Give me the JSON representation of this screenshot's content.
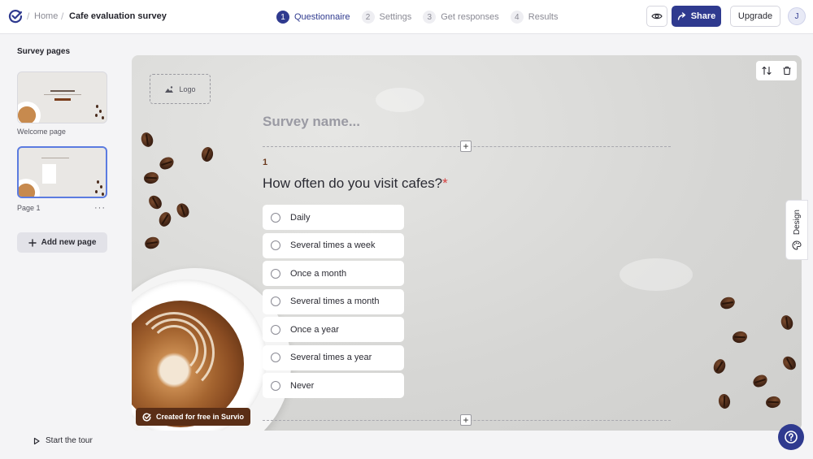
{
  "header": {
    "home_label": "Home",
    "separator": "/",
    "survey_title": "Cafe evaluation survey",
    "steps": [
      {
        "num": "1",
        "label": "Questionnaire"
      },
      {
        "num": "2",
        "label": "Settings"
      },
      {
        "num": "3",
        "label": "Get responses"
      },
      {
        "num": "4",
        "label": "Results"
      }
    ],
    "share_label": "Share",
    "upgrade_label": "Upgrade",
    "avatar_initial": "J",
    "accent_color": "#2f3a8f"
  },
  "sidebar": {
    "title": "Survey pages",
    "pages": [
      {
        "label": "Welcome page"
      },
      {
        "label": "Page 1"
      }
    ],
    "more_label": "···",
    "add_page_label": "Add new page",
    "tour_label": "Start the tour"
  },
  "canvas": {
    "logo_label": "Logo",
    "survey_name_placeholder": "Survey name...",
    "question": {
      "number": "1",
      "text": "How often do you visit cafes?",
      "required_mark": "*",
      "options": [
        "Daily",
        "Several times a week",
        "Once a month",
        "Several times a month",
        "Once a year",
        "Several times a year",
        "Never"
      ]
    },
    "badge_label": "Created for free in Survio"
  },
  "side": {
    "design_label": "Design"
  }
}
